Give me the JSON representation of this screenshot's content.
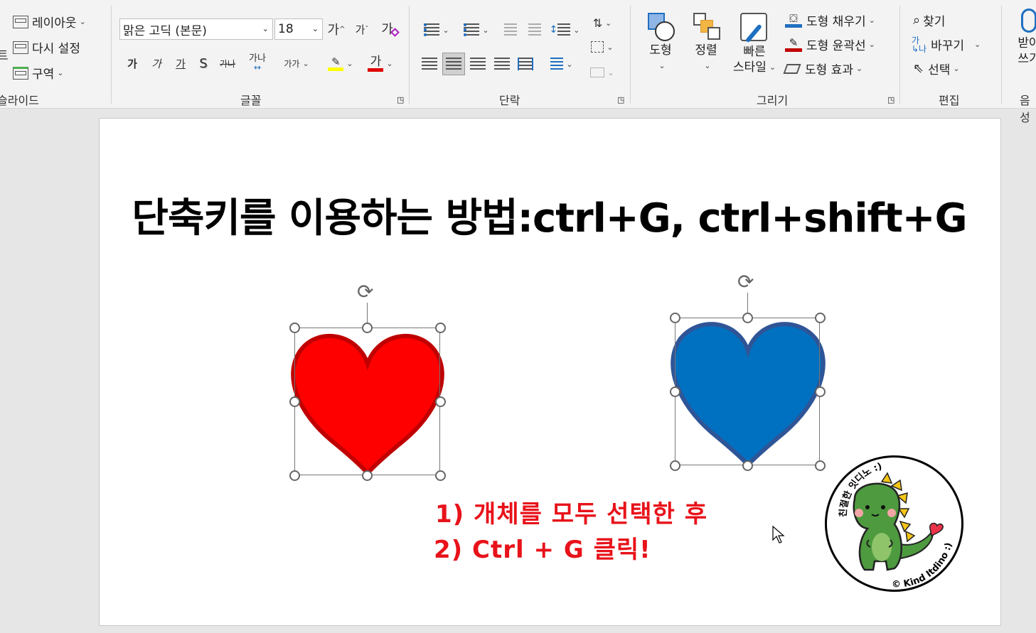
{
  "ribbon": {
    "slides_group": {
      "label": "슬라이드",
      "layout": "레이아웃",
      "reset": "다시 설정",
      "section": "구역",
      "clipped_left": "트"
    },
    "font_group": {
      "label": "글꼴",
      "font_name": "맑은 고딕 (본문)",
      "font_size": "18",
      "grow_font": "가",
      "shrink_font": "가",
      "clear_format": "가",
      "bold": "가",
      "italic": "가",
      "underline": "가",
      "shadow": "S",
      "strike": "가나",
      "char_spacing": "가나",
      "change_case": "가가",
      "highlight_color": "#ffff00",
      "font_color_char": "가",
      "font_color": "#e00000"
    },
    "paragraph_group": {
      "label": "단락"
    },
    "drawing_group": {
      "label": "그리기",
      "shape": "도형",
      "arrange": "정렬",
      "quick_style_line1": "빠른",
      "quick_style_line2": "스타일",
      "shape_fill": "도형 채우기",
      "shape_outline": "도형 윤곽선",
      "shape_effects": "도형 효과",
      "fill_color": "#1f6fc0",
      "outline_color": "#c00000"
    },
    "editing_group": {
      "label": "편집",
      "find": "찾기",
      "replace": "바꾸기",
      "select": "선택"
    },
    "voice_group": {
      "dictate_line1": "받아",
      "dictate_line2": "쓰기",
      "label": "음성"
    }
  },
  "slide": {
    "title": "단축키를 이용하는 방법:ctrl+G, ctrl+shift+G",
    "instruction_1": "1) 개체를 모두 선택한 후",
    "instruction_2": "2) Ctrl + G 클릭!",
    "heart_red_fill": "#ff0000",
    "heart_red_outline": "#c00000",
    "heart_blue_fill": "#0070c0",
    "heart_blue_outline": "#2f5597",
    "stamp_text_top": "친절한 잇디노 :)",
    "stamp_text_bottom": "© Kind Itdino :)"
  }
}
